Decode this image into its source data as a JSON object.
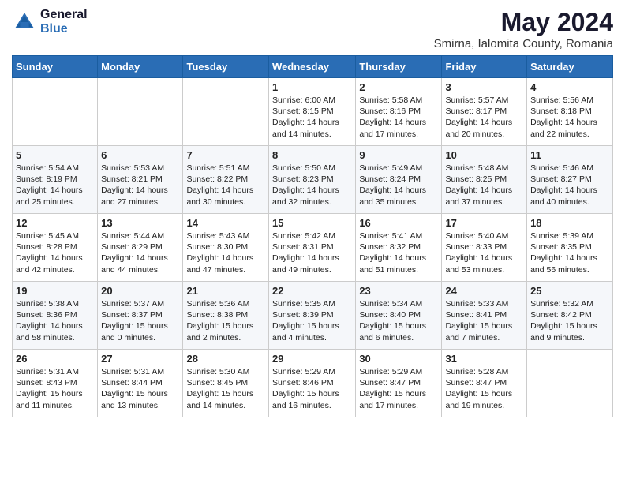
{
  "logo": {
    "general": "General",
    "blue": "Blue"
  },
  "title": "May 2024",
  "subtitle": "Smirna, Ialomita County, Romania",
  "days_header": [
    "Sunday",
    "Monday",
    "Tuesday",
    "Wednesday",
    "Thursday",
    "Friday",
    "Saturday"
  ],
  "weeks": [
    [
      {
        "day": "",
        "info": ""
      },
      {
        "day": "",
        "info": ""
      },
      {
        "day": "",
        "info": ""
      },
      {
        "day": "1",
        "info": "Sunrise: 6:00 AM\nSunset: 8:15 PM\nDaylight: 14 hours\nand 14 minutes."
      },
      {
        "day": "2",
        "info": "Sunrise: 5:58 AM\nSunset: 8:16 PM\nDaylight: 14 hours\nand 17 minutes."
      },
      {
        "day": "3",
        "info": "Sunrise: 5:57 AM\nSunset: 8:17 PM\nDaylight: 14 hours\nand 20 minutes."
      },
      {
        "day": "4",
        "info": "Sunrise: 5:56 AM\nSunset: 8:18 PM\nDaylight: 14 hours\nand 22 minutes."
      }
    ],
    [
      {
        "day": "5",
        "info": "Sunrise: 5:54 AM\nSunset: 8:19 PM\nDaylight: 14 hours\nand 25 minutes."
      },
      {
        "day": "6",
        "info": "Sunrise: 5:53 AM\nSunset: 8:21 PM\nDaylight: 14 hours\nand 27 minutes."
      },
      {
        "day": "7",
        "info": "Sunrise: 5:51 AM\nSunset: 8:22 PM\nDaylight: 14 hours\nand 30 minutes."
      },
      {
        "day": "8",
        "info": "Sunrise: 5:50 AM\nSunset: 8:23 PM\nDaylight: 14 hours\nand 32 minutes."
      },
      {
        "day": "9",
        "info": "Sunrise: 5:49 AM\nSunset: 8:24 PM\nDaylight: 14 hours\nand 35 minutes."
      },
      {
        "day": "10",
        "info": "Sunrise: 5:48 AM\nSunset: 8:25 PM\nDaylight: 14 hours\nand 37 minutes."
      },
      {
        "day": "11",
        "info": "Sunrise: 5:46 AM\nSunset: 8:27 PM\nDaylight: 14 hours\nand 40 minutes."
      }
    ],
    [
      {
        "day": "12",
        "info": "Sunrise: 5:45 AM\nSunset: 8:28 PM\nDaylight: 14 hours\nand 42 minutes."
      },
      {
        "day": "13",
        "info": "Sunrise: 5:44 AM\nSunset: 8:29 PM\nDaylight: 14 hours\nand 44 minutes."
      },
      {
        "day": "14",
        "info": "Sunrise: 5:43 AM\nSunset: 8:30 PM\nDaylight: 14 hours\nand 47 minutes."
      },
      {
        "day": "15",
        "info": "Sunrise: 5:42 AM\nSunset: 8:31 PM\nDaylight: 14 hours\nand 49 minutes."
      },
      {
        "day": "16",
        "info": "Sunrise: 5:41 AM\nSunset: 8:32 PM\nDaylight: 14 hours\nand 51 minutes."
      },
      {
        "day": "17",
        "info": "Sunrise: 5:40 AM\nSunset: 8:33 PM\nDaylight: 14 hours\nand 53 minutes."
      },
      {
        "day": "18",
        "info": "Sunrise: 5:39 AM\nSunset: 8:35 PM\nDaylight: 14 hours\nand 56 minutes."
      }
    ],
    [
      {
        "day": "19",
        "info": "Sunrise: 5:38 AM\nSunset: 8:36 PM\nDaylight: 14 hours\nand 58 minutes."
      },
      {
        "day": "20",
        "info": "Sunrise: 5:37 AM\nSunset: 8:37 PM\nDaylight: 15 hours\nand 0 minutes."
      },
      {
        "day": "21",
        "info": "Sunrise: 5:36 AM\nSunset: 8:38 PM\nDaylight: 15 hours\nand 2 minutes."
      },
      {
        "day": "22",
        "info": "Sunrise: 5:35 AM\nSunset: 8:39 PM\nDaylight: 15 hours\nand 4 minutes."
      },
      {
        "day": "23",
        "info": "Sunrise: 5:34 AM\nSunset: 8:40 PM\nDaylight: 15 hours\nand 6 minutes."
      },
      {
        "day": "24",
        "info": "Sunrise: 5:33 AM\nSunset: 8:41 PM\nDaylight: 15 hours\nand 7 minutes."
      },
      {
        "day": "25",
        "info": "Sunrise: 5:32 AM\nSunset: 8:42 PM\nDaylight: 15 hours\nand 9 minutes."
      }
    ],
    [
      {
        "day": "26",
        "info": "Sunrise: 5:31 AM\nSunset: 8:43 PM\nDaylight: 15 hours\nand 11 minutes."
      },
      {
        "day": "27",
        "info": "Sunrise: 5:31 AM\nSunset: 8:44 PM\nDaylight: 15 hours\nand 13 minutes."
      },
      {
        "day": "28",
        "info": "Sunrise: 5:30 AM\nSunset: 8:45 PM\nDaylight: 15 hours\nand 14 minutes."
      },
      {
        "day": "29",
        "info": "Sunrise: 5:29 AM\nSunset: 8:46 PM\nDaylight: 15 hours\nand 16 minutes."
      },
      {
        "day": "30",
        "info": "Sunrise: 5:29 AM\nSunset: 8:47 PM\nDaylight: 15 hours\nand 17 minutes."
      },
      {
        "day": "31",
        "info": "Sunrise: 5:28 AM\nSunset: 8:47 PM\nDaylight: 15 hours\nand 19 minutes."
      },
      {
        "day": "",
        "info": ""
      }
    ]
  ]
}
